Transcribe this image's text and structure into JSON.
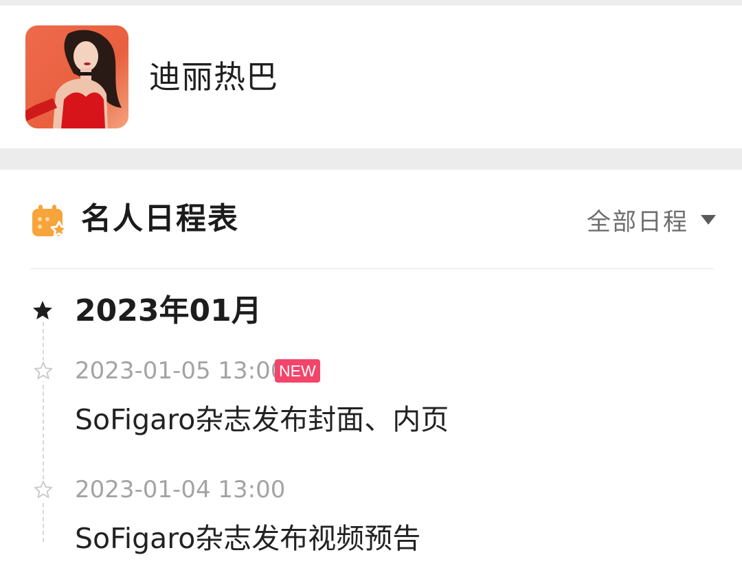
{
  "profile": {
    "name": "迪丽热巴"
  },
  "schedule": {
    "title": "名人日程表",
    "filter_label": "全部日程",
    "month": "2023年01月",
    "events": [
      {
        "time": "2023-01-05 13:00",
        "badge": "NEW",
        "title": "SoFigaro杂志发布封面、内页"
      },
      {
        "time": "2023-01-04 13:00",
        "title": "SoFigaro杂志发布视频预告"
      }
    ]
  },
  "colors": {
    "accent_orange": "#f7a43a",
    "new_badge": "#f3446a",
    "page_gap": "#ececec"
  },
  "icons": {
    "schedule": "calendar-star-icon",
    "month": "star-filled-icon",
    "event": "star-outline-icon",
    "filter": "caret-down-icon"
  }
}
